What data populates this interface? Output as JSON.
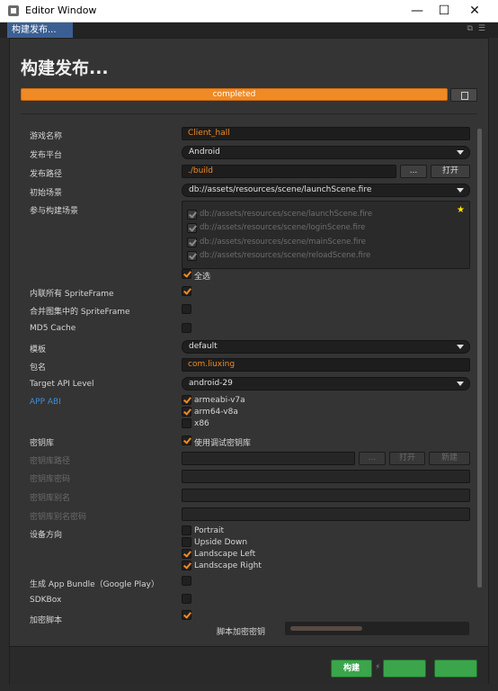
{
  "window": {
    "title": "Editor Window",
    "controls": [
      "—",
      "☐",
      "✕"
    ]
  },
  "tab": {
    "label": "构建发布..."
  },
  "panel": {
    "title": "构建发布...",
    "progress_text": "completed",
    "progress_value": 1.0
  },
  "fields": {
    "game_name": {
      "label": "游戏名称",
      "value": "Client_hall"
    },
    "platform": {
      "label": "发布平台",
      "value": "Android"
    },
    "build_path": {
      "label": "发布路径",
      "value": "./build",
      "browse": "...",
      "open": "打开"
    },
    "start_scene": {
      "label": "初始场景",
      "value": "db://assets/resources/scene/launchScene.fire"
    },
    "scenes": {
      "label": "参与构建场景",
      "items": [
        "db://assets/resources/scene/launchScene.fire",
        "db://assets/resources/scene/loginScene.fire",
        "db://assets/resources/scene/mainScene.fire",
        "db://assets/resources/scene/reloadScene.fire"
      ],
      "select_all": "全选"
    },
    "inline_sprite": {
      "label": "内联所有 SpriteFrame"
    },
    "merge_sprite": {
      "label": "合并图集中的 SpriteFrame"
    },
    "md5": {
      "label": "MD5 Cache"
    },
    "template": {
      "label": "模板",
      "value": "default"
    },
    "package": {
      "label": "包名",
      "value": "com.liuxing"
    },
    "api_level": {
      "label": "Target API Level",
      "value": "android-29"
    },
    "abi": {
      "label": "APP ABI",
      "options": [
        "armeabi-v7a",
        "arm64-v8a",
        "x86"
      ]
    },
    "keystore": {
      "label": "密钥库",
      "debug_label": "使用调试密钥库"
    },
    "keystore_path": {
      "label": "密钥库路径",
      "browse": "...",
      "open": "打开",
      "new": "新建"
    },
    "keystore_pwd": {
      "label": "密钥库密码"
    },
    "keystore_alias": {
      "label": "密钥库别名"
    },
    "keystore_alias_pwd": {
      "label": "密钥库别名密码"
    },
    "orientation": {
      "label": "设备方向",
      "options": [
        "Portrait",
        "Upside Down",
        "Landscape Left",
        "Landscape Right"
      ]
    },
    "app_bundle": {
      "label": "生成 App Bundle（Google Play）"
    },
    "sdkbox": {
      "label": "SDKBox"
    },
    "encrypt": {
      "label": "加密脚本",
      "key_label": "脚本加密密钥"
    }
  },
  "footer": {
    "build": "构建"
  },
  "colors": {
    "accent": "#f08a24",
    "tab": "#3b5f93",
    "green": "#3aa54a",
    "blue_label": "#3b8ee0"
  }
}
